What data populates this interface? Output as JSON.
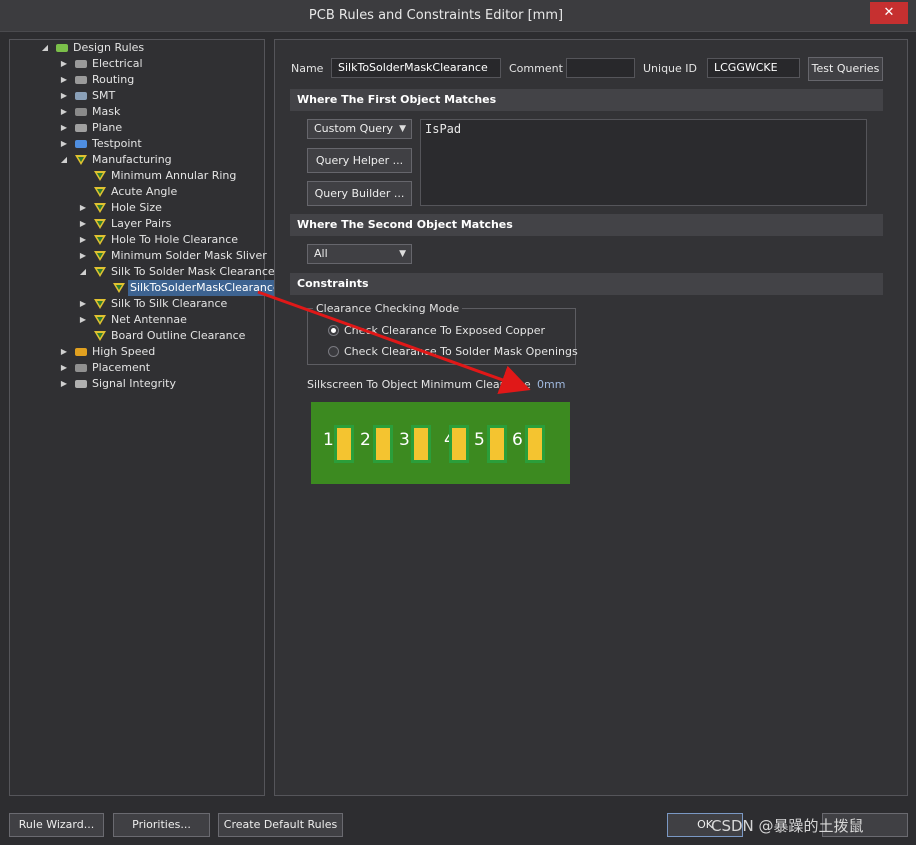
{
  "window": {
    "title": "PCB Rules and Constraints Editor [mm]",
    "close": "✕"
  },
  "tree": [
    {
      "label": "Design Rules",
      "indent": 0,
      "arrow": "◢",
      "icon": "design-rules-icon"
    },
    {
      "label": "Electrical",
      "indent": 1,
      "arrow": "▶",
      "icon": "electrical-icon"
    },
    {
      "label": "Routing",
      "indent": 1,
      "arrow": "▶",
      "icon": "routing-icon"
    },
    {
      "label": "SMT",
      "indent": 1,
      "arrow": "▶",
      "icon": "smt-icon"
    },
    {
      "label": "Mask",
      "indent": 1,
      "arrow": "▶",
      "icon": "mask-icon"
    },
    {
      "label": "Plane",
      "indent": 1,
      "arrow": "▶",
      "icon": "plane-icon"
    },
    {
      "label": "Testpoint",
      "indent": 1,
      "arrow": "▶",
      "icon": "testpoint-icon"
    },
    {
      "label": "Manufacturing",
      "indent": 1,
      "arrow": "◢",
      "icon": "manufacturing-icon"
    },
    {
      "label": "Minimum Annular Ring",
      "indent": 2,
      "arrow": "",
      "icon": "rule-icon"
    },
    {
      "label": "Acute Angle",
      "indent": 2,
      "arrow": "",
      "icon": "rule-icon"
    },
    {
      "label": "Hole Size",
      "indent": 2,
      "arrow": "▶",
      "icon": "rule-icon"
    },
    {
      "label": "Layer Pairs",
      "indent": 2,
      "arrow": "▶",
      "icon": "rule-icon"
    },
    {
      "label": "Hole To Hole Clearance",
      "indent": 2,
      "arrow": "▶",
      "icon": "rule-icon"
    },
    {
      "label": "Minimum Solder Mask Sliver",
      "indent": 2,
      "arrow": "▶",
      "icon": "rule-icon"
    },
    {
      "label": "Silk To Solder Mask Clearance",
      "indent": 2,
      "arrow": "◢",
      "icon": "rule-icon"
    },
    {
      "label": "SilkToSolderMaskClearance",
      "indent": 3,
      "arrow": "",
      "icon": "rule-icon",
      "selected": true
    },
    {
      "label": "Silk To Silk Clearance",
      "indent": 2,
      "arrow": "▶",
      "icon": "rule-icon"
    },
    {
      "label": "Net Antennae",
      "indent": 2,
      "arrow": "▶",
      "icon": "rule-icon"
    },
    {
      "label": "Board Outline Clearance",
      "indent": 2,
      "arrow": "",
      "icon": "rule-icon"
    },
    {
      "label": "High Speed",
      "indent": 1,
      "arrow": "▶",
      "icon": "high-speed-icon"
    },
    {
      "label": "Placement",
      "indent": 1,
      "arrow": "▶",
      "icon": "placement-icon"
    },
    {
      "label": "Signal Integrity",
      "indent": 1,
      "arrow": "▶",
      "icon": "signal-integrity-icon"
    }
  ],
  "rule": {
    "name_label": "Name",
    "name_value": "SilkToSolderMaskClearance",
    "comment_label": "Comment",
    "comment_value": "",
    "unique_id_label": "Unique ID",
    "unique_id_value": "LCGGWCKE",
    "test_queries": "Test Queries"
  },
  "first_match": {
    "header": "Where The First Object Matches",
    "mode": "Custom Query",
    "query_helper": "Query Helper ...",
    "query_builder": "Query Builder ...",
    "query": "IsPad"
  },
  "second_match": {
    "header": "Where The Second Object Matches",
    "mode": "All"
  },
  "constraints": {
    "header": "Constraints",
    "group_title": "Clearance Checking Mode",
    "option1": "Check Clearance To Exposed Copper",
    "option2": "Check Clearance To Solder Mask Openings",
    "selected_option": 1,
    "min_clearance_label": "Silkscreen To Object Minimum Clearance",
    "min_clearance_value": "0mm",
    "pad_numbers": [
      "1",
      "2",
      "3",
      "4",
      "5",
      "6"
    ]
  },
  "buttons": {
    "rule_wizard": "Rule Wizard...",
    "priorities": "Priorities...",
    "create_default": "Create Default Rules",
    "ok": "OK"
  },
  "watermark": "CSDN @暴躁的土拨鼠",
  "colors": {
    "annotation_arrow": "#e01818",
    "selection": "#3d6391",
    "pcb_green": "#3c8a20",
    "pad_yellow": "#f4c430"
  }
}
